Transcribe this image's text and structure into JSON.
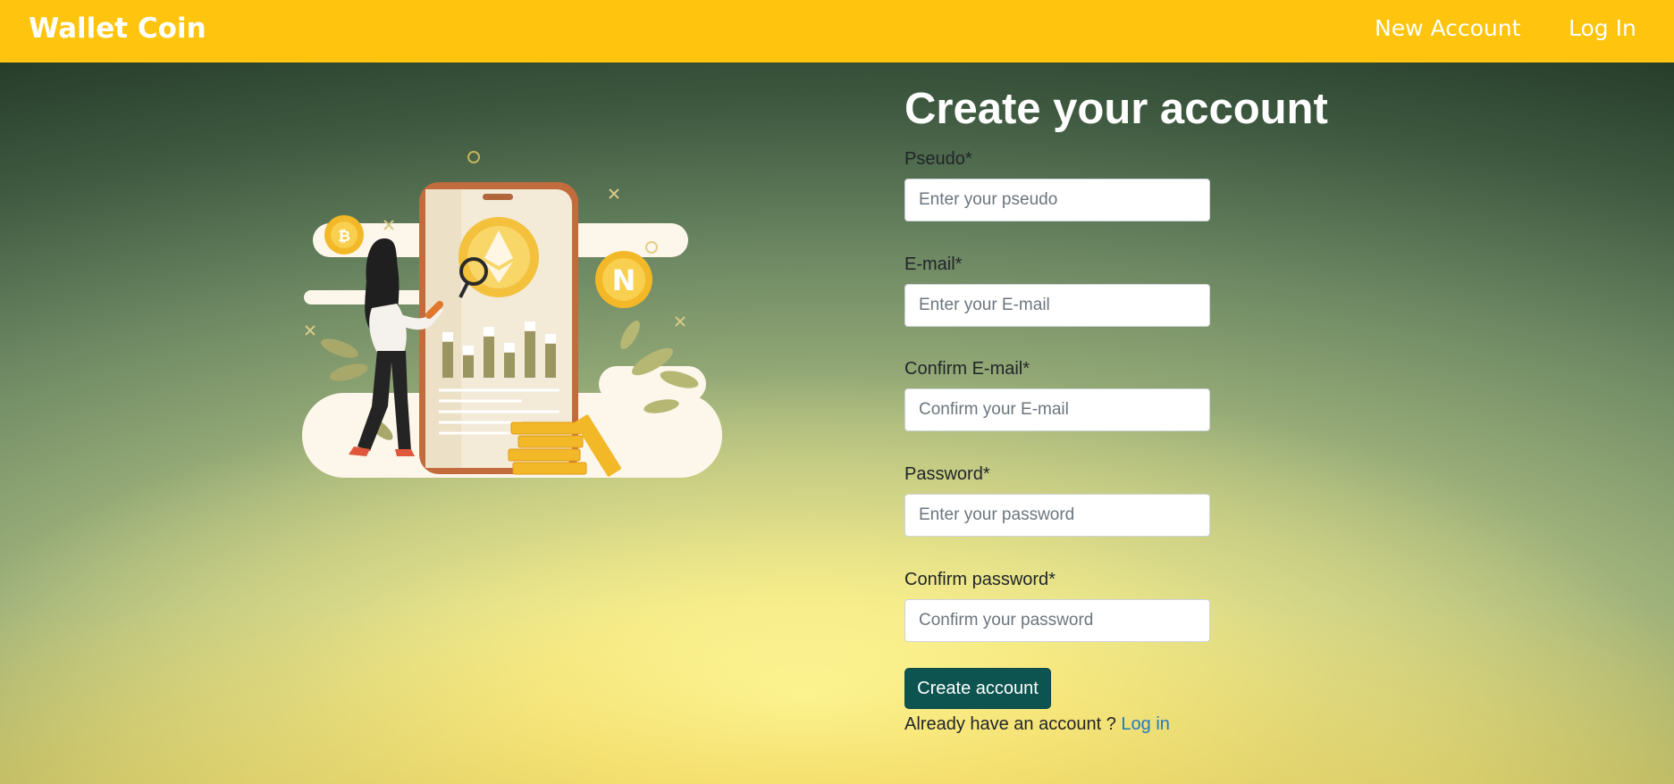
{
  "nav": {
    "brand": "Wallet Coin",
    "new_account": "New Account",
    "log_in": "Log In"
  },
  "form": {
    "title": "Create your account",
    "fields": [
      {
        "label": "Pseudo*",
        "placeholder": "Enter your pseudo",
        "value": ""
      },
      {
        "label": "E-mail*",
        "placeholder": "Enter your E-mail",
        "value": ""
      },
      {
        "label": "Confirm E-mail*",
        "placeholder": "Confirm your E-mail",
        "value": ""
      },
      {
        "label": "Password*",
        "placeholder": "Enter your password",
        "value": ""
      },
      {
        "label": "Confirm password*",
        "placeholder": "Confirm your password",
        "value": ""
      }
    ],
    "submit_label": "Create account",
    "login_prompt": "Already have an account ?",
    "login_link": "Log in"
  },
  "colors": {
    "navbar": "#ffc40d",
    "button": "#0d5450",
    "link": "#1f7bc4"
  },
  "icons": {
    "coin_bitcoin": "bitcoin-coin-icon",
    "coin_ethereum": "ethereum-coin-icon",
    "coin_n": "n-coin-icon"
  }
}
